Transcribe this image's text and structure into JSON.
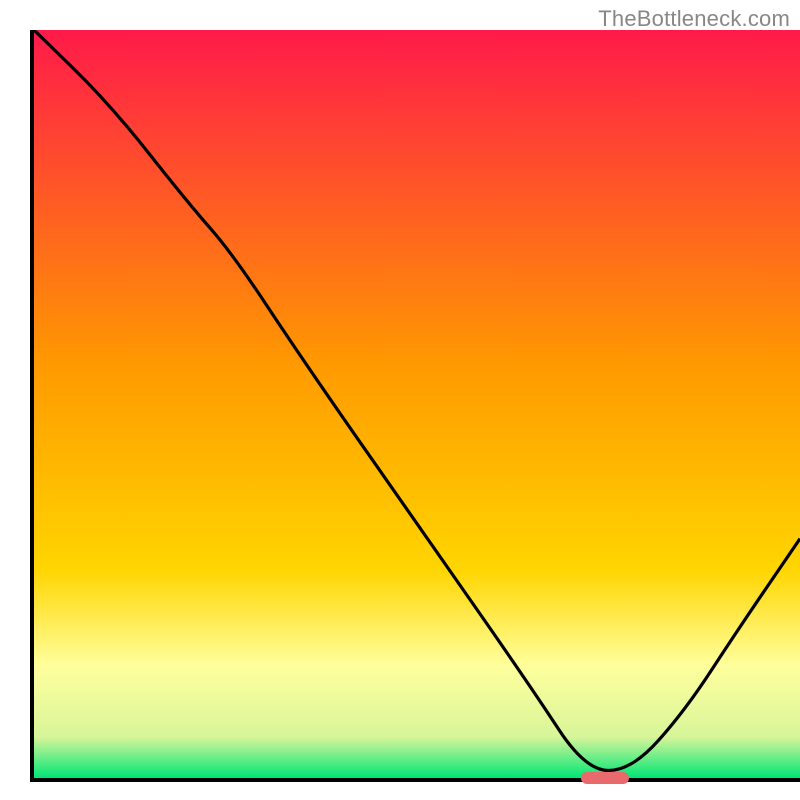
{
  "watermark": "TheBottleneck.com",
  "colors": {
    "top": "#ff1a4a",
    "mid": "#ffd500",
    "bottom_light": "#ffff9c",
    "green_band_top": "#d8f59a",
    "green_band_bottom": "#00e676",
    "axis": "#000000",
    "curve": "#000000",
    "marker": "#e96a6d"
  },
  "marker": {
    "x_frac": 0.745,
    "width_frac": 0.063
  },
  "chart_data": {
    "type": "line",
    "title": "",
    "xlabel": "",
    "ylabel": "",
    "xlim": [
      0,
      1
    ],
    "ylim": [
      0,
      1
    ],
    "series": [
      {
        "name": "curve",
        "x": [
          0.0,
          0.1,
          0.2,
          0.26,
          0.35,
          0.5,
          0.65,
          0.72,
          0.78,
          0.85,
          0.92,
          1.0
        ],
        "y": [
          1.0,
          0.9,
          0.77,
          0.7,
          0.56,
          0.34,
          0.12,
          0.01,
          0.01,
          0.09,
          0.2,
          0.32
        ]
      }
    ],
    "green_band_y": [
      0.0,
      0.055
    ],
    "light_band_y": [
      0.055,
      0.17
    ]
  }
}
